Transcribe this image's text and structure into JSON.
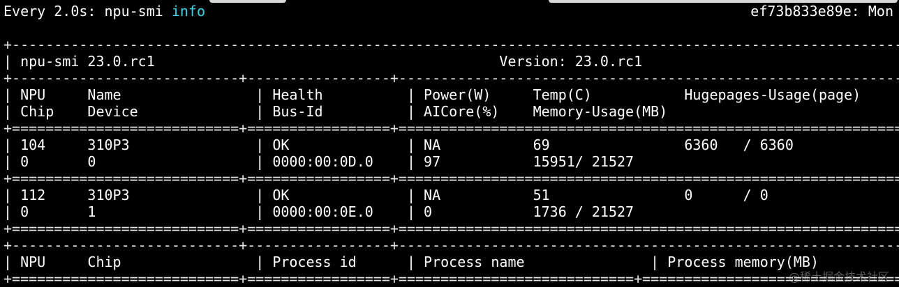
{
  "header": {
    "watch_prefix": "Every 2.0s: npu-smi ",
    "watch_keyword": "info",
    "host_status": "ef73b833e89e: Mon"
  },
  "table": {
    "lines": [
      "",
      "+------------------------------------------------------------------------------------------------------------------------------------------+",
      "| npu-smi 23.0.rc1                                         Version: 23.0.rc1                                                                 |",
      "+---------------------------+-----------------+----------------------------------------------------------------------------------------------+",
      "| NPU     Name                | Health          | Power(W)     Temp(C)           Hugepages-Usage(page)                                         |",
      "| Chip    Device              | Bus-Id          | AICore(%)    Memory-Usage(MB)                                                                |",
      "+===========================+=================+==============================================================================================+",
      "| 104     310P3               | OK              | NA           69                6360   / 6360                                                 |",
      "| 0       0                   | 0000:00:0D.0    | 97           15951/ 21527                                                                    |",
      "+===========================+=================+==============================================================================================+",
      "| 112     310P3               | OK              | NA           51                0      / 0                                                    |",
      "| 0       1                   | 0000:00:0E.0    | 0            1736 / 21527                                                                    |",
      "+===========================+=================+==============================================================================================+",
      "+---------------------------+-----------------+----------------------------------------------------------------------------------------------+",
      "| NPU     Chip                | Process id      | Process name               | Process memory(MB)                                             |",
      "+===========================+=================+============================+=================================================================+"
    ]
  },
  "watermark": "@稀土掘金技术社区",
  "colors": {
    "background": "#000000",
    "text": "#ffffff",
    "keyword": "#3cd6e6"
  }
}
